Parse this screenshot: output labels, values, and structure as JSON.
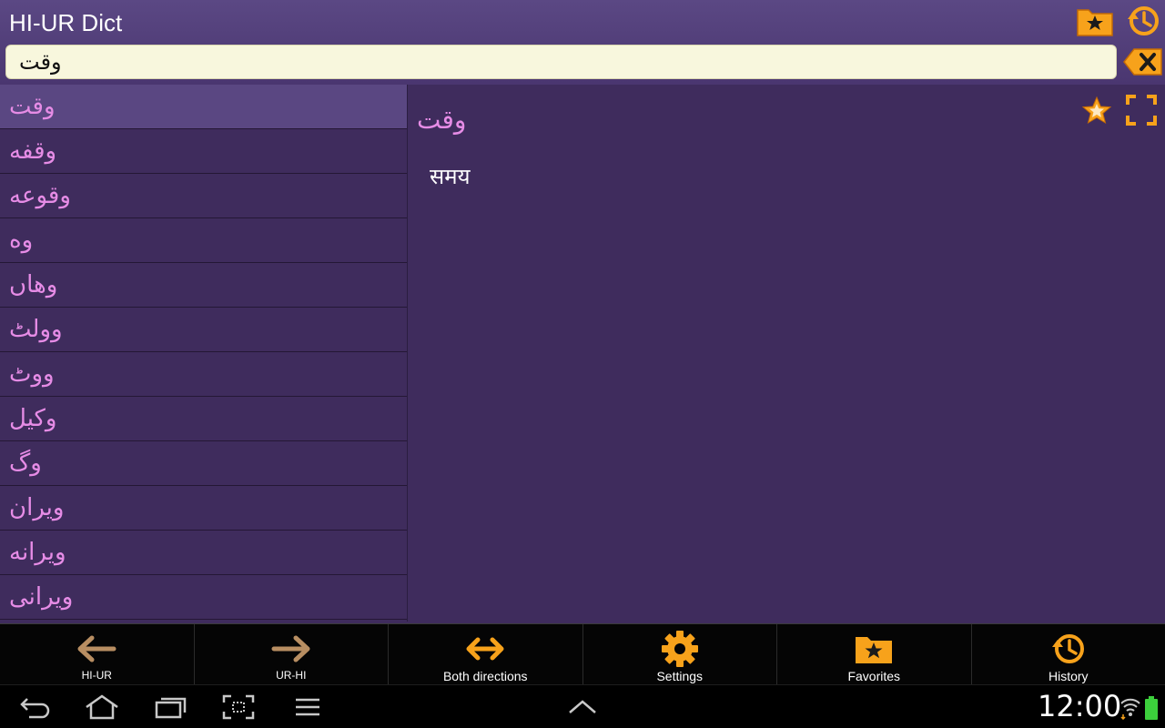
{
  "header": {
    "title": "HI-UR Dict",
    "search_value": "وقت",
    "favorites_icon": "favorites-folder-icon",
    "history_icon": "history-icon",
    "clear_icon": "backspace-clear-icon"
  },
  "word_list": {
    "items": [
      {
        "text": "وقت",
        "selected": true
      },
      {
        "text": "وقفه",
        "selected": false
      },
      {
        "text": "وقوعه",
        "selected": false
      },
      {
        "text": "وه",
        "selected": false
      },
      {
        "text": "وهاں",
        "selected": false
      },
      {
        "text": "وولٹ",
        "selected": false
      },
      {
        "text": "ووٹ",
        "selected": false
      },
      {
        "text": "وکیل",
        "selected": false
      },
      {
        "text": "وگ",
        "selected": false
      },
      {
        "text": "ویران",
        "selected": false
      },
      {
        "text": "ویرانه",
        "selected": false
      },
      {
        "text": "ویرانی",
        "selected": false
      }
    ]
  },
  "detail": {
    "word": "وقت",
    "translation": "समय"
  },
  "toolbar": {
    "items": [
      {
        "label": "HI-UR",
        "icon": "arrow-left-icon"
      },
      {
        "label": "UR-HI",
        "icon": "arrow-right-icon"
      },
      {
        "label": "Both directions",
        "icon": "arrow-both-icon"
      },
      {
        "label": "Settings",
        "icon": "gear-icon"
      },
      {
        "label": "Favorites",
        "icon": "favorites-folder-icon"
      },
      {
        "label": "History",
        "icon": "history-icon"
      }
    ]
  },
  "system_bar": {
    "clock": "12:00"
  },
  "colors": {
    "accent": "#f39a1e",
    "word_text": "#e68ce6",
    "background": "#3f2c5d",
    "search_bg": "#f8f7dd"
  }
}
